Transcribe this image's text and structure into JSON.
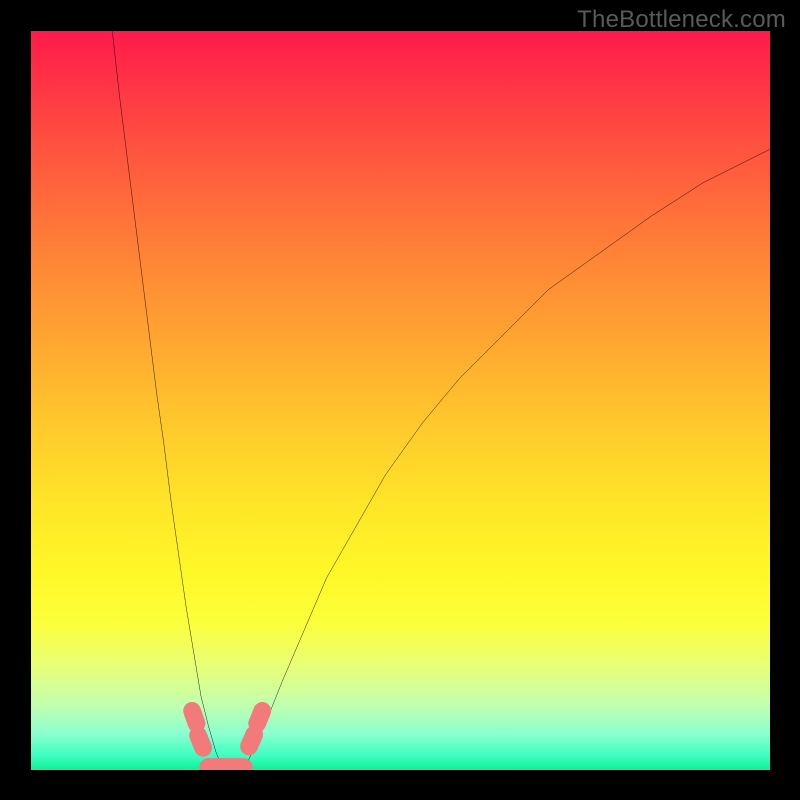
{
  "watermark": "TheBottleneck.com",
  "chart_data": {
    "type": "line",
    "title": "",
    "xlabel": "",
    "ylabel": "",
    "xlim": [
      0,
      100
    ],
    "ylim": [
      0,
      100
    ],
    "series": [
      {
        "name": "left-curve",
        "x": [
          11,
          12,
          13,
          14,
          15,
          16,
          17,
          18,
          19,
          20,
          21,
          22,
          23,
          24,
          25,
          25.8
        ],
        "y": [
          100,
          91,
          83,
          75,
          67,
          59,
          51,
          44,
          36,
          29,
          22,
          16,
          10,
          6,
          2.5,
          0.5
        ]
      },
      {
        "name": "right-curve",
        "x": [
          29,
          30,
          32,
          34,
          37,
          40,
          44,
          48,
          53,
          58,
          64,
          70,
          77,
          84,
          91,
          98,
          100
        ],
        "y": [
          0.5,
          2.5,
          7,
          12,
          19,
          26,
          33,
          40,
          47,
          53,
          59,
          65,
          70,
          75,
          79.5,
          83,
          84
        ]
      }
    ],
    "markers": [
      {
        "name": "floor-bar-left",
        "shape": "capsule",
        "x1": 24.0,
        "y1": 0.4,
        "x2": 28.8,
        "y2": 0.4,
        "r": 1.2,
        "color": "#f27a7a"
      },
      {
        "name": "left-blob-lower",
        "shape": "capsule",
        "x1": 22.6,
        "y1": 4.7,
        "x2": 23.3,
        "y2": 3.0,
        "r": 1.2,
        "color": "#f27a7a"
      },
      {
        "name": "left-blob-upper",
        "shape": "capsule",
        "x1": 21.8,
        "y1": 8.0,
        "x2": 22.4,
        "y2": 6.3,
        "r": 1.2,
        "color": "#f27a7a"
      },
      {
        "name": "right-blob-lower",
        "shape": "capsule",
        "x1": 29.5,
        "y1": 3.2,
        "x2": 30.2,
        "y2": 4.8,
        "r": 1.2,
        "color": "#f27a7a"
      },
      {
        "name": "right-blob-upper",
        "shape": "capsule",
        "x1": 30.6,
        "y1": 6.3,
        "x2": 31.3,
        "y2": 8.0,
        "r": 1.2,
        "color": "#f27a7a"
      }
    ],
    "background_gradient": {
      "type": "vertical",
      "stops": [
        {
          "pos": 0.0,
          "color": "#ff1a4b"
        },
        {
          "pos": 0.5,
          "color": "#ffc82c"
        },
        {
          "pos": 0.8,
          "color": "#fcff3a"
        },
        {
          "pos": 1.0,
          "color": "#10f09a"
        }
      ]
    }
  }
}
